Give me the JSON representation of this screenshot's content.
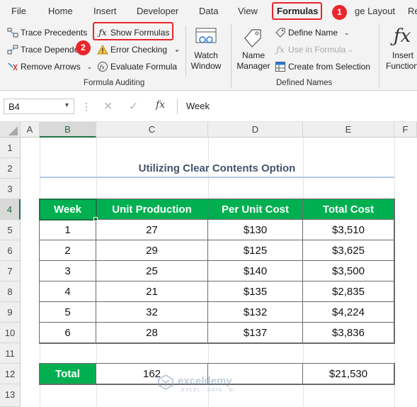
{
  "menu": {
    "tabs": [
      "File",
      "Home",
      "Insert",
      "Developer",
      "Data",
      "View",
      "Formulas",
      "ge Layout",
      "Re"
    ],
    "active_tab": "Formulas"
  },
  "badges": {
    "step1": "1",
    "step2": "2"
  },
  "ribbon": {
    "formula_auditing": {
      "trace_precedents": "Trace Precedents",
      "trace_dependents": "Trace Depende",
      "remove_arrows": "Remove Arrows",
      "show_formulas": "Show Formulas",
      "error_checking": "Error Checking",
      "evaluate_formula": "Evaluate Formula",
      "watch_window_line1": "Watch",
      "watch_window_line2": "Window",
      "group_label": "Formula Auditing"
    },
    "defined_names": {
      "name_manager_line1": "Name",
      "name_manager_line2": "Manager",
      "define_name": "Define Name",
      "use_in_formula": "Use in Formula",
      "create_from_selection": "Create from Selection",
      "group_label": "Defined Names"
    },
    "insert_function_line1": "Insert",
    "insert_function_line2": "Function"
  },
  "formula_bar": {
    "name_box": "B4",
    "fx_label": "fx",
    "content": "Week"
  },
  "columns": [
    "A",
    "B",
    "C",
    "D",
    "E",
    "F"
  ],
  "rows": [
    "1",
    "2",
    "3",
    "4",
    "5",
    "6",
    "7",
    "8",
    "9",
    "10",
    "11",
    "12",
    "13"
  ],
  "sheet": {
    "title": "Utilizing Clear Contents Option",
    "headers": [
      "Week",
      "Unit Production",
      "Per Unit Cost",
      "Total Cost"
    ],
    "rows": [
      [
        "1",
        "27",
        "$130",
        "$3,510"
      ],
      [
        "2",
        "29",
        "$125",
        "$3,625"
      ],
      [
        "3",
        "25",
        "$140",
        "$3,500"
      ],
      [
        "4",
        "21",
        "$135",
        "$2,835"
      ],
      [
        "5",
        "32",
        "$132",
        "$4,224"
      ],
      [
        "6",
        "28",
        "$137",
        "$3,836"
      ]
    ],
    "total": [
      "Total",
      "162",
      "",
      "$21,530"
    ]
  },
  "watermark": {
    "name": "exceldemy",
    "tagline": "EXCEL · DATA · BI"
  },
  "colors": {
    "accent": "#217346",
    "header_fill": "#00b050",
    "highlight": "#e8262c"
  }
}
